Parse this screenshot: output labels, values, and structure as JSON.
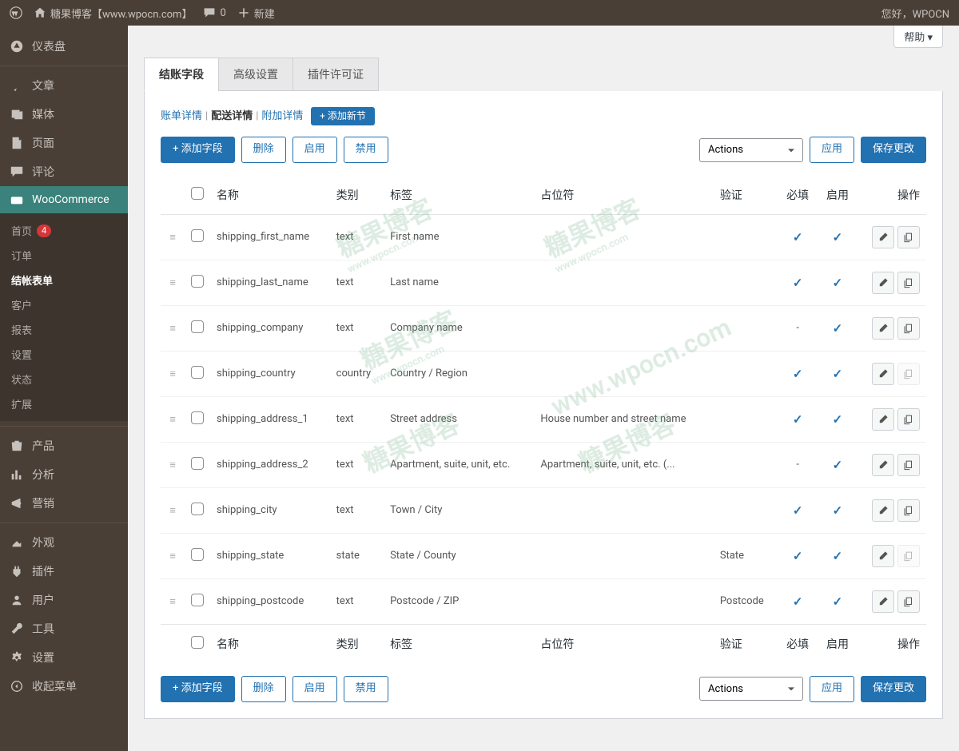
{
  "adminbar": {
    "site_name": "糖果博客【www.wpocn.com】",
    "comment_count": "0",
    "new_label": "新建",
    "greeting": "您好，WPOCN"
  },
  "help_label": "帮助",
  "sidebar": {
    "items": [
      {
        "label": "仪表盘",
        "icon": "dashboard"
      },
      {
        "label": "文章",
        "icon": "pin"
      },
      {
        "label": "媒体",
        "icon": "media"
      },
      {
        "label": "页面",
        "icon": "page"
      },
      {
        "label": "评论",
        "icon": "comment"
      },
      {
        "label": "WooCommerce",
        "icon": "woo",
        "active": true
      },
      {
        "label": "产品",
        "icon": "product"
      },
      {
        "label": "分析",
        "icon": "analytics"
      },
      {
        "label": "营销",
        "icon": "marketing"
      },
      {
        "label": "外观",
        "icon": "appearance"
      },
      {
        "label": "插件",
        "icon": "plugins"
      },
      {
        "label": "用户",
        "icon": "users"
      },
      {
        "label": "工具",
        "icon": "tools"
      },
      {
        "label": "设置",
        "icon": "settings"
      },
      {
        "label": "收起菜单",
        "icon": "collapse"
      }
    ],
    "submenu": [
      {
        "label": "首页",
        "badge": "4"
      },
      {
        "label": "订单"
      },
      {
        "label": "结帐表单",
        "active": true
      },
      {
        "label": "客户"
      },
      {
        "label": "报表"
      },
      {
        "label": "设置"
      },
      {
        "label": "状态"
      },
      {
        "label": "扩展"
      }
    ]
  },
  "tabs": [
    {
      "label": "结账字段",
      "active": true
    },
    {
      "label": "高级设置"
    },
    {
      "label": "插件许可证"
    }
  ],
  "subsections": {
    "items": [
      "账单详情",
      "配送详情",
      "附加详情"
    ],
    "current_index": 1,
    "add_section": "+ 添加新节"
  },
  "toolbar": {
    "add_field": "+ 添加字段",
    "delete": "删除",
    "enable": "启用",
    "disable": "禁用",
    "actions_placeholder": "Actions",
    "apply": "应用",
    "save": "保存更改"
  },
  "table": {
    "headers": {
      "name": "名称",
      "type": "类别",
      "label": "标签",
      "placeholder": "占位符",
      "validation": "验证",
      "required": "必填",
      "enabled": "启用",
      "actions": "操作"
    },
    "rows": [
      {
        "name": "shipping_first_name",
        "type": "text",
        "label": "First name",
        "placeholder": "",
        "validation": "",
        "required": true,
        "enabled": true,
        "copy_enabled": true
      },
      {
        "name": "shipping_last_name",
        "type": "text",
        "label": "Last name",
        "placeholder": "",
        "validation": "",
        "required": true,
        "enabled": true,
        "copy_enabled": true
      },
      {
        "name": "shipping_company",
        "type": "text",
        "label": "Company name",
        "placeholder": "",
        "validation": "",
        "required": "-",
        "enabled": true,
        "copy_enabled": true
      },
      {
        "name": "shipping_country",
        "type": "country",
        "label": "Country / Region",
        "placeholder": "",
        "validation": "",
        "required": true,
        "enabled": true,
        "copy_enabled": false
      },
      {
        "name": "shipping_address_1",
        "type": "text",
        "label": "Street address",
        "placeholder": "House number and street name",
        "validation": "",
        "required": true,
        "enabled": true,
        "copy_enabled": true
      },
      {
        "name": "shipping_address_2",
        "type": "text",
        "label": "Apartment, suite, unit, etc.",
        "placeholder": "Apartment, suite, unit, etc. (...",
        "validation": "",
        "required": "-",
        "enabled": true,
        "copy_enabled": true
      },
      {
        "name": "shipping_city",
        "type": "text",
        "label": "Town / City",
        "placeholder": "",
        "validation": "",
        "required": true,
        "enabled": true,
        "copy_enabled": true
      },
      {
        "name": "shipping_state",
        "type": "state",
        "label": "State / County",
        "placeholder": "",
        "validation": "State",
        "required": true,
        "enabled": true,
        "copy_enabled": false
      },
      {
        "name": "shipping_postcode",
        "type": "text",
        "label": "Postcode / ZIP",
        "placeholder": "",
        "validation": "Postcode",
        "required": true,
        "enabled": true,
        "copy_enabled": true
      }
    ]
  },
  "watermark": {
    "text": "糖果博客",
    "url": "www.wpocn.com"
  }
}
